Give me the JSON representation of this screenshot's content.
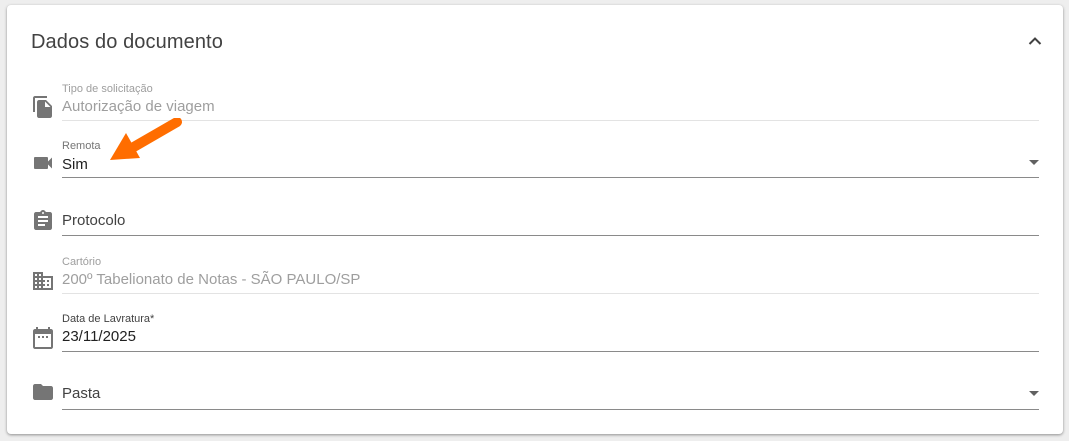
{
  "card": {
    "title": "Dados do documento"
  },
  "fields": [
    {
      "label": "Tipo de solicitação",
      "value": "Autorização de viagem",
      "icon": "file-copy-icon",
      "disabled": true
    },
    {
      "label": "Remota",
      "value": "Sim",
      "icon": "videocam-icon",
      "type": "select"
    },
    {
      "label": "",
      "value": "Protocolo",
      "icon": "assignment-icon",
      "type": "text",
      "value_is_placeholder": true
    },
    {
      "label": "Cartório",
      "value": "200º Tabelionato de Notas - SÃO PAULO/SP",
      "icon": "building-icon",
      "disabled": true
    },
    {
      "label": "Data de Lavratura*",
      "value": "23/11/2025",
      "icon": "calendar-icon",
      "type": "date"
    },
    {
      "label": "",
      "value": "Pasta",
      "icon": "folder-icon",
      "type": "select",
      "value_is_placeholder": true
    }
  ],
  "annotation": {
    "icon": "orange-arrow-annotation",
    "color": "#ff6d00"
  },
  "colors": {
    "icon": "#757575",
    "text": "#212121",
    "muted": "#9e9e9e",
    "underline": "#8a8a8a",
    "background": "#eeeeee"
  }
}
